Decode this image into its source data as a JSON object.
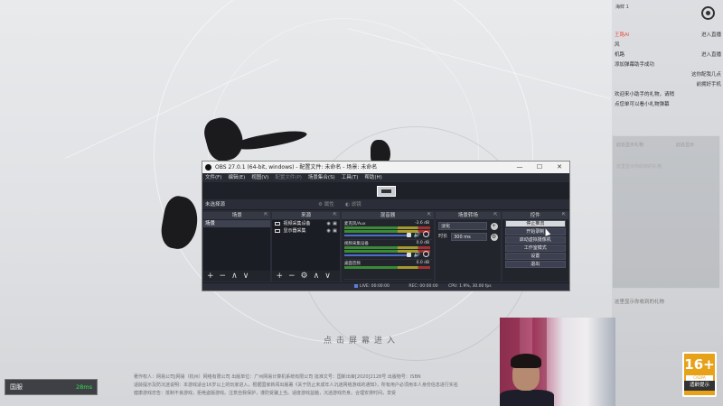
{
  "background": {
    "tap_to_enter": "点击屏幕进入",
    "footer_line1": "著作权人：网易公司|网易（杭州）网络有限公司 出版单位：广州网易计算机系统有限公司 批准文号：国新出审[2020]2128号 出版物号：ISBN",
    "footer_line2": "适龄提示及防沉迷说明：本游戏适合16岁以上的玩家进入，根据国家新闻出版署《关于防止未成年人沉迷网络游戏的通知》，所有用户必须用本人身份信息进行实名",
    "footer_line3": "健康游戏忠告：抵制不良游戏，拒绝盗版游戏。注意自我保护，谨防受骗上当。适度游戏益脑，沉迷游戏伤身。合理安排时间，享受"
  },
  "stream_overlay": {
    "top_label": "海鲜 1",
    "chat": [
      {
        "nick": "王路Al",
        "text": "",
        "action": "进入直播"
      },
      {
        "nick": "",
        "text": "风",
        "action": ""
      },
      {
        "nick": "",
        "text": "机路",
        "action": "进入直播"
      },
      {
        "nick": "",
        "text": "添加弹幕助手成功",
        "action": ""
      },
      {
        "nick": "",
        "text": "",
        "action": "这你配我几点"
      },
      {
        "nick": "",
        "text": "",
        "action": "前拥好手机"
      },
      {
        "nick": "",
        "text": "欢迎来小助手的礼物，请稍",
        "action": ""
      },
      {
        "nick": "",
        "text": "点您单可以看小礼物弹幕",
        "action": ""
      }
    ],
    "panel_tag_left": "此处显示礼物",
    "panel_tag_right": "此处显示",
    "panel_hint": "这里显示你收到的礼物",
    "gift_hint": "这里显示你收到的礼物"
  },
  "age_rating": {
    "age": "16+",
    "org": "CADPA",
    "label": "适龄提示"
  },
  "server": {
    "name": "国服",
    "ping": "28ms"
  },
  "obs": {
    "title": "OBS 27.0.1 (64-bit, windows) - 配置文件: 未命名 - 场景: 未命名",
    "win_min": "—",
    "win_max": "☐",
    "win_close": "✕",
    "menu": [
      "文件(F)",
      "编辑(E)",
      "视图(V)",
      "配置文件(P)",
      "场景集合(S)",
      "工具(T)",
      "帮助(H)"
    ],
    "toolbar": {
      "no_scene": "未选择源",
      "properties": "属性",
      "filters": "滤镜"
    },
    "docks": {
      "scenes": {
        "title": "场景",
        "items": [
          "场景"
        ]
      },
      "sources": {
        "title": "来源",
        "items": [
          "视频采集设备",
          "显示器采集"
        ]
      },
      "mixer": {
        "title": "混音器",
        "channels": [
          {
            "name": "麦克风/Aux",
            "db": "-3.6 dB"
          },
          {
            "name": "视频采集设备",
            "db": "0.0 dB"
          },
          {
            "name": "桌面音频",
            "db": "0.0 dB"
          }
        ]
      },
      "transitions": {
        "title": "场景转场",
        "fade": "淡化",
        "duration_label": "时长",
        "duration": "300 ms"
      },
      "controls": {
        "title": "控件",
        "buttons": [
          "停止推流",
          "开始录制",
          "启动虚拟摄像机",
          "工作室模式",
          "设置",
          "退出"
        ]
      }
    },
    "status": {
      "live": "LIVE: 00:00:00",
      "rec": "REC: 00:00:00",
      "cpu": "CPU: 1.9%, 30.00 fps"
    }
  }
}
